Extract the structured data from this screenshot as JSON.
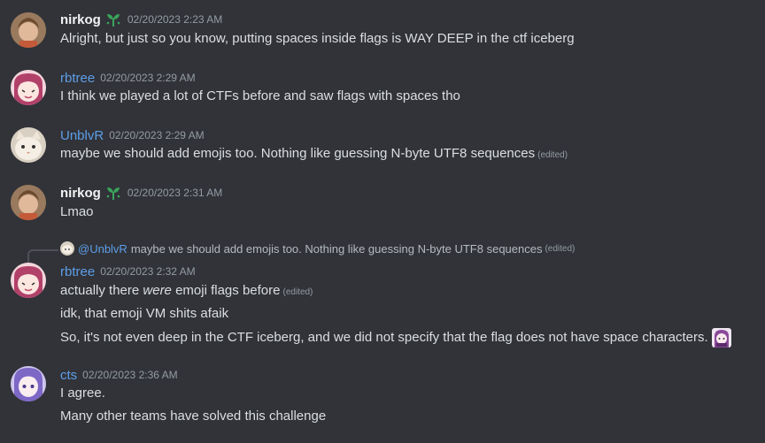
{
  "messages": [
    {
      "author": "nirkog",
      "timestamp": "02/20/2023 2:23 AM",
      "lines": [
        "Alright, but just so you know, putting spaces inside flags is WAY DEEP in the ctf iceberg"
      ]
    },
    {
      "author": "rbtree",
      "timestamp": "02/20/2023 2:29 AM",
      "lines": [
        "I think we played a lot of CTFs before and saw flags with spaces tho"
      ]
    },
    {
      "author": "UnblvR",
      "timestamp": "02/20/2023 2:29 AM",
      "lines": [
        "maybe we should add emojis too. Nothing like guessing N-byte UTF8 sequences"
      ],
      "edited": "(edited)"
    },
    {
      "author": "nirkog",
      "timestamp": "02/20/2023 2:31 AM",
      "lines": [
        "Lmao"
      ]
    },
    {
      "author": "rbtree",
      "timestamp": "02/20/2023 2:32 AM",
      "reply": {
        "author": "@UnblvR",
        "text": "maybe we should add emojis too. Nothing like guessing N-byte UTF8 sequences",
        "edited": "(edited)"
      },
      "line1_pre": "actually there ",
      "line1_em": "were",
      "line1_post": " emoji flags before",
      "edited": "(edited)",
      "lines": [
        "idk, that emoji VM shits afaik",
        "So, it's not even deep in the CTF iceberg, and we did not specify that the flag does not have space characters."
      ]
    },
    {
      "author": "cts",
      "timestamp": "02/20/2023 2:36 AM",
      "lines": [
        "I agree.",
        "Many other teams have solved this challenge"
      ]
    }
  ],
  "colors": {
    "background": "#313338",
    "link_author": "#5e9ee8",
    "badge": "#3ba55c"
  }
}
